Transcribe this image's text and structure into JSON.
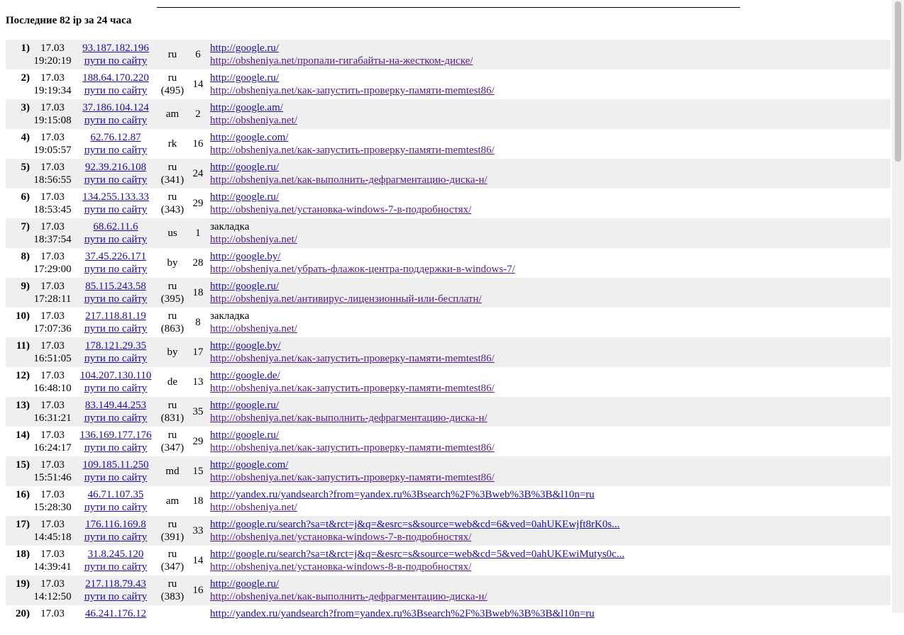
{
  "heading": "Последние 82 ip за 24 часа",
  "paths_label": "пути по сайту",
  "rows": [
    {
      "num": "1)",
      "date": "17.03",
      "time": "19:20:19",
      "ip": "93.187.182.196",
      "country": "ru",
      "region": "",
      "count": "6",
      "referrer": "http://google.ru/",
      "referrer_is_link": true,
      "page": "http://obsheniya.net/пропали-гигабайты-на-жестком-диске/"
    },
    {
      "num": "2)",
      "date": "17.03",
      "time": "19:19:34",
      "ip": "188.64.170.220",
      "country": "ru",
      "region": "(495)",
      "count": "14",
      "referrer": "http://google.ru/",
      "referrer_is_link": true,
      "page": "http://obsheniya.net/как-запустить-проверку-памяти-memtest86/"
    },
    {
      "num": "3)",
      "date": "17.03",
      "time": "19:15:08",
      "ip": "37.186.104.124",
      "country": "am",
      "region": "",
      "count": "2",
      "referrer": "http://google.am/",
      "referrer_is_link": true,
      "page": "http://obsheniya.net/"
    },
    {
      "num": "4)",
      "date": "17.03",
      "time": "19:05:57",
      "ip": "62.76.12.87",
      "country": "rk",
      "region": "",
      "count": "16",
      "referrer": "http://google.com/",
      "referrer_is_link": true,
      "page": "http://obsheniya.net/как-запустить-проверку-памяти-memtest86/"
    },
    {
      "num": "5)",
      "date": "17.03",
      "time": "18:56:55",
      "ip": "92.39.216.108",
      "country": "ru",
      "region": "(341)",
      "count": "24",
      "referrer": "http://google.ru/",
      "referrer_is_link": true,
      "page": "http://obsheniya.net/как-выполнить-дефрагментацию-диска-н/"
    },
    {
      "num": "6)",
      "date": "17.03",
      "time": "18:53:45",
      "ip": "134.255.133.33",
      "country": "ru",
      "region": "(343)",
      "count": "29",
      "referrer": "http://google.ru/",
      "referrer_is_link": true,
      "page": "http://obsheniya.net/установка-windows-7-в-подробностях/"
    },
    {
      "num": "7)",
      "date": "17.03",
      "time": "18:37:54",
      "ip": "68.62.11.6",
      "country": "us",
      "region": "",
      "count": "1",
      "referrer": "закладка",
      "referrer_is_link": false,
      "page": "http://obsheniya.net/"
    },
    {
      "num": "8)",
      "date": "17.03",
      "time": "17:29:00",
      "ip": "37.45.226.171",
      "country": "by",
      "region": "",
      "count": "28",
      "referrer": "http://google.by/",
      "referrer_is_link": true,
      "page": "http://obsheniya.net/убрать-флажок-центра-поддержки-в-windows-7/"
    },
    {
      "num": "9)",
      "date": "17.03",
      "time": "17:28:11",
      "ip": "85.115.243.58",
      "country": "ru",
      "region": "(395)",
      "count": "18",
      "referrer": "http://google.ru/",
      "referrer_is_link": true,
      "page": "http://obsheniya.net/антивирус-лицензионный-или-бесплатн/"
    },
    {
      "num": "10)",
      "date": "17.03",
      "time": "17:07:36",
      "ip": "217.118.81.19",
      "country": "ru",
      "region": "(863)",
      "count": "8",
      "referrer": "закладка",
      "referrer_is_link": false,
      "page": "http://obsheniya.net/"
    },
    {
      "num": "11)",
      "date": "17.03",
      "time": "16:51:05",
      "ip": "178.121.29.35",
      "country": "by",
      "region": "",
      "count": "17",
      "referrer": "http://google.by/",
      "referrer_is_link": true,
      "page": "http://obsheniya.net/как-запустить-проверку-памяти-memtest86/"
    },
    {
      "num": "12)",
      "date": "17.03",
      "time": "16:48:10",
      "ip": "104.207.130.110",
      "country": "de",
      "region": "",
      "count": "13",
      "referrer": "http://google.de/",
      "referrer_is_link": true,
      "page": "http://obsheniya.net/как-запустить-проверку-памяти-memtest86/"
    },
    {
      "num": "13)",
      "date": "17.03",
      "time": "16:31:21",
      "ip": "83.149.44.253",
      "country": "ru",
      "region": "(831)",
      "count": "35",
      "referrer": "http://google.ru/",
      "referrer_is_link": true,
      "page": "http://obsheniya.net/как-выполнить-дефрагментацию-диска-н/"
    },
    {
      "num": "14)",
      "date": "17.03",
      "time": "16:24:17",
      "ip": "136.169.177.176",
      "country": "ru",
      "region": "(347)",
      "count": "29",
      "referrer": "http://google.ru/",
      "referrer_is_link": true,
      "page": "http://obsheniya.net/как-запустить-проверку-памяти-memtest86/"
    },
    {
      "num": "15)",
      "date": "17.03",
      "time": "15:51:46",
      "ip": "109.185.11.250",
      "country": "md",
      "region": "",
      "count": "15",
      "referrer": "http://google.com/",
      "referrer_is_link": true,
      "page": "http://obsheniya.net/как-запустить-проверку-памяти-memtest86/"
    },
    {
      "num": "16)",
      "date": "17.03",
      "time": "15:28:30",
      "ip": "46.71.107.35",
      "country": "am",
      "region": "",
      "count": "18",
      "referrer": "http://yandex.ru/yandsearch?from=yandex.ru%3Bsearch%2F%3Bweb%3B%3B&l10n=ru",
      "referrer_is_link": true,
      "page": "http://obsheniya.net/"
    },
    {
      "num": "17)",
      "date": "17.03",
      "time": "14:45:18",
      "ip": "176.116.169.8",
      "country": "ru",
      "region": "(391)",
      "count": "33",
      "referrer": "http://google.ru/search?sa=t&rct=j&q=&esrc=s&source=web&cd=6&ved=0ahUKEwjft8rK0s...",
      "referrer_is_link": true,
      "page": "http://obsheniya.net/установка-windows-7-в-подробностях/"
    },
    {
      "num": "18)",
      "date": "17.03",
      "time": "14:39:41",
      "ip": "31.8.245.120",
      "country": "ru",
      "region": "(347)",
      "count": "14",
      "referrer": "http://google.ru/search?sa=t&rct=j&q=&esrc=s&source=web&cd=5&ved=0ahUKEwiMutys0c...",
      "referrer_is_link": true,
      "page": "http://obsheniya.net/установка-windows-8-в-подробностях/"
    },
    {
      "num": "19)",
      "date": "17.03",
      "time": "14:12:50",
      "ip": "217.118.79.43",
      "country": "ru",
      "region": "(383)",
      "count": "16",
      "referrer": "http://google.ru/",
      "referrer_is_link": true,
      "page": "http://obsheniya.net/как-выполнить-дефрагментацию-диска-н/"
    },
    {
      "num": "20)",
      "date": "17.03",
      "time": "",
      "ip": "46.241.176.12",
      "country": "",
      "region": "",
      "count": "",
      "referrer": "http://yandex.ru/yandsearch?from=yandex.ru%3Bsearch%2F%3Bweb%3B%3B&l10n=ru",
      "referrer_is_link": true,
      "page": ""
    }
  ]
}
